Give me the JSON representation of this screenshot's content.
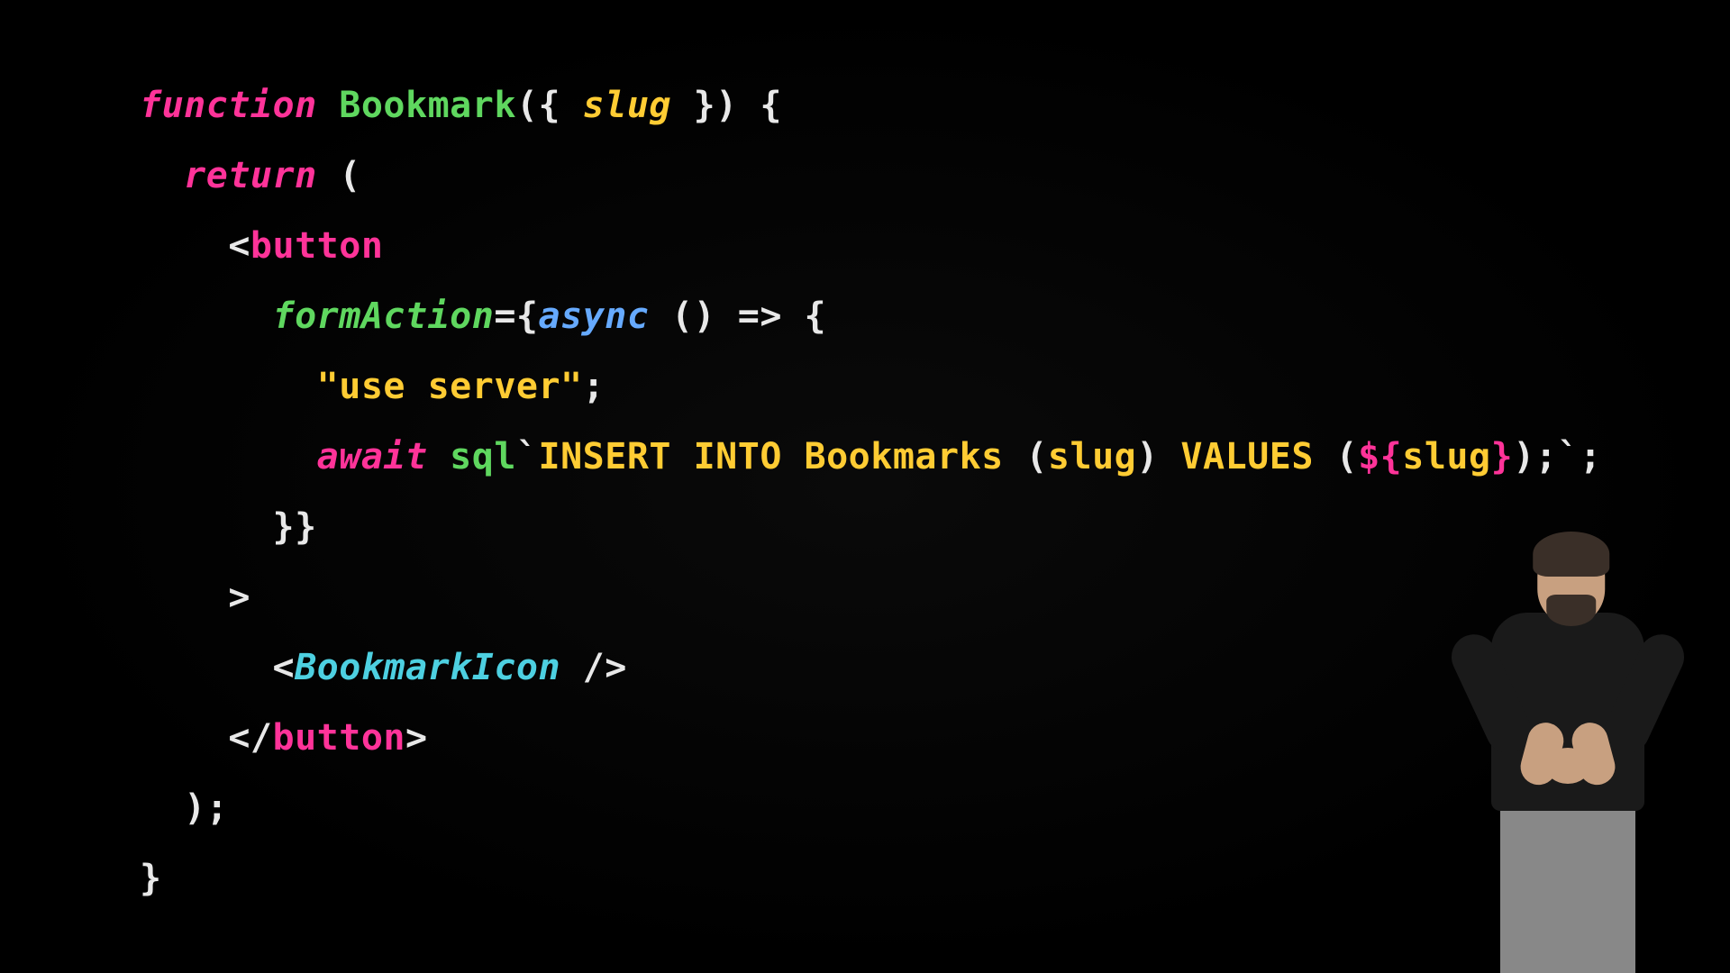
{
  "code": {
    "l1": {
      "kw": "function",
      "fn": "Bookmark",
      "p1": "({ ",
      "param": "slug",
      "p2": " }) {"
    },
    "l2": {
      "kw": "return",
      "p": " ("
    },
    "l3": {
      "br": "<",
      "tag": "button"
    },
    "l4": {
      "attr": "formAction",
      "eq": "={",
      "async": "async",
      "arrow": " () => {"
    },
    "l5": {
      "str": "\"use server\"",
      "semi": ";"
    },
    "l6": {
      "await": "await",
      "sp": " ",
      "fn": "sql",
      "bt": "`",
      "sql1": "INSERT INTO Bookmarks ",
      "par1": "(",
      "col": "slug",
      "par2": ") ",
      "sql2": "VALUES ",
      "par3": "(",
      "interp_open": "${",
      "var": "slug",
      "interp_close": "}",
      "par4": ");",
      "bt2": "`",
      "semi": ";"
    },
    "l7": {
      "close": "}}"
    },
    "l8": {
      "gt": ">"
    },
    "l9": {
      "br1": "<",
      "comp": "BookmarkIcon",
      "br2": " />"
    },
    "l10": {
      "br1": "</",
      "tag": "button",
      "br2": ">"
    },
    "l11": {
      "p": ");"
    },
    "l12": {
      "p": "}"
    }
  },
  "speaker": {
    "description": "presenter"
  }
}
